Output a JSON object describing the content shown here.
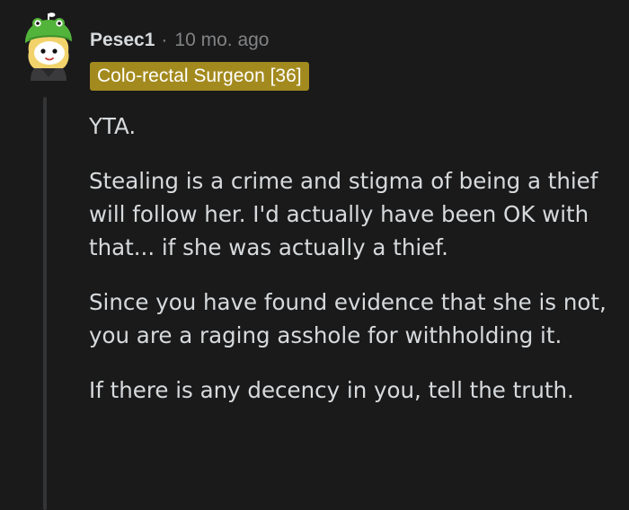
{
  "comment": {
    "author": "Pesec1",
    "separator": "·",
    "timestamp": "10 mo. ago",
    "flair": "Colo-rectal Surgeon [36]",
    "avatar_icon": "snoo-avatar-icon",
    "paragraphs": [
      "YTA.",
      "Stealing is a crime and stigma of being a thief will follow her. I'd actually have been OK with that... if she was actually a thief.",
      "Since you have found evidence that she is not, you are a raging asshole for withholding it.",
      "If there is any decency in you, tell the truth."
    ]
  },
  "colors": {
    "background": "#1a1a1b",
    "text": "#d7dadc",
    "muted": "#818384",
    "flair_bg": "#a38a1e",
    "thread_line": "#343536",
    "avatar_hat": "#53b43b"
  }
}
